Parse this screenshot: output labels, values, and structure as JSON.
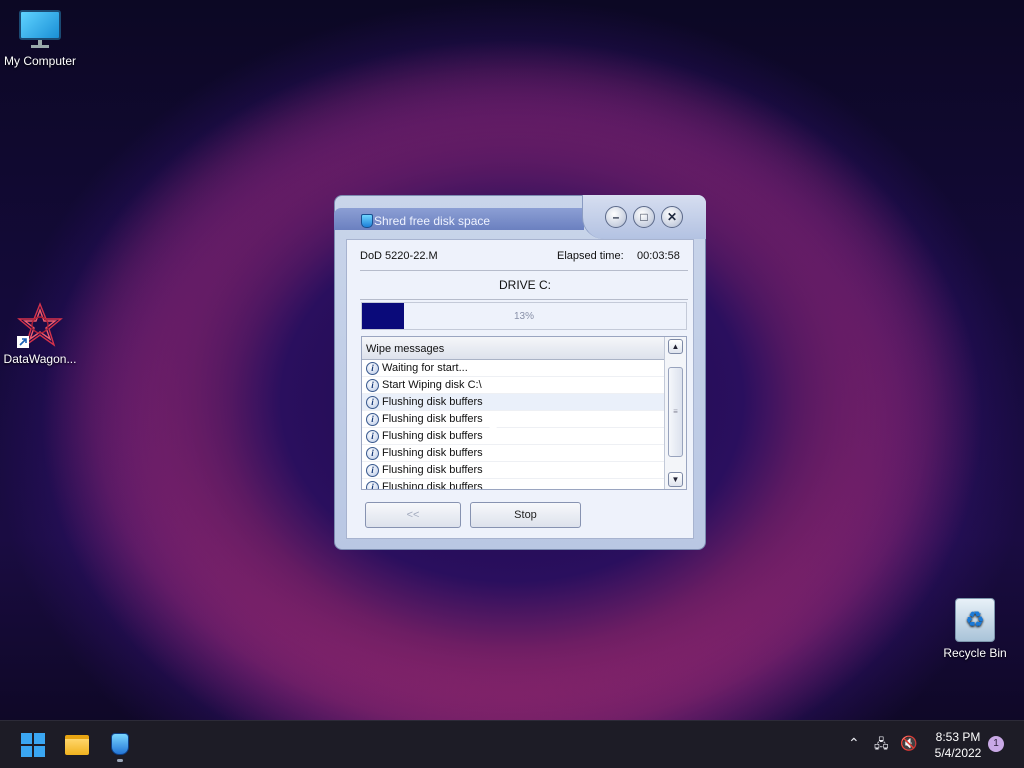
{
  "desktop": {
    "icons": [
      {
        "label": "My Computer",
        "icon": "monitor-icon"
      },
      {
        "label": "DataWagon...",
        "icon": "datawagon-logo-icon"
      },
      {
        "label": "Recycle Bin",
        "icon": "recycle-bin-icon"
      }
    ]
  },
  "window": {
    "title": "Shred free disk space",
    "method": "DoD 5220-22.M",
    "elapsed_label": "Elapsed time:",
    "elapsed_value": "00:03:58",
    "drive_label": "DRIVE C:",
    "progress_percent": 13,
    "progress_text": "13%",
    "messages_header": "Wipe messages",
    "messages": [
      "Waiting for start...",
      "Start Wiping disk C:\\",
      "Flushing disk buffers",
      "Flushing disk buffers",
      "Flushing disk buffers",
      "Flushing disk buffers",
      "Flushing disk buffers",
      "Flushing disk buffers"
    ],
    "back_button": "<<",
    "stop_button": "Stop"
  },
  "taskbar": {
    "time": "8:53 PM",
    "date": "5/4/2022",
    "notification_count": "1"
  }
}
